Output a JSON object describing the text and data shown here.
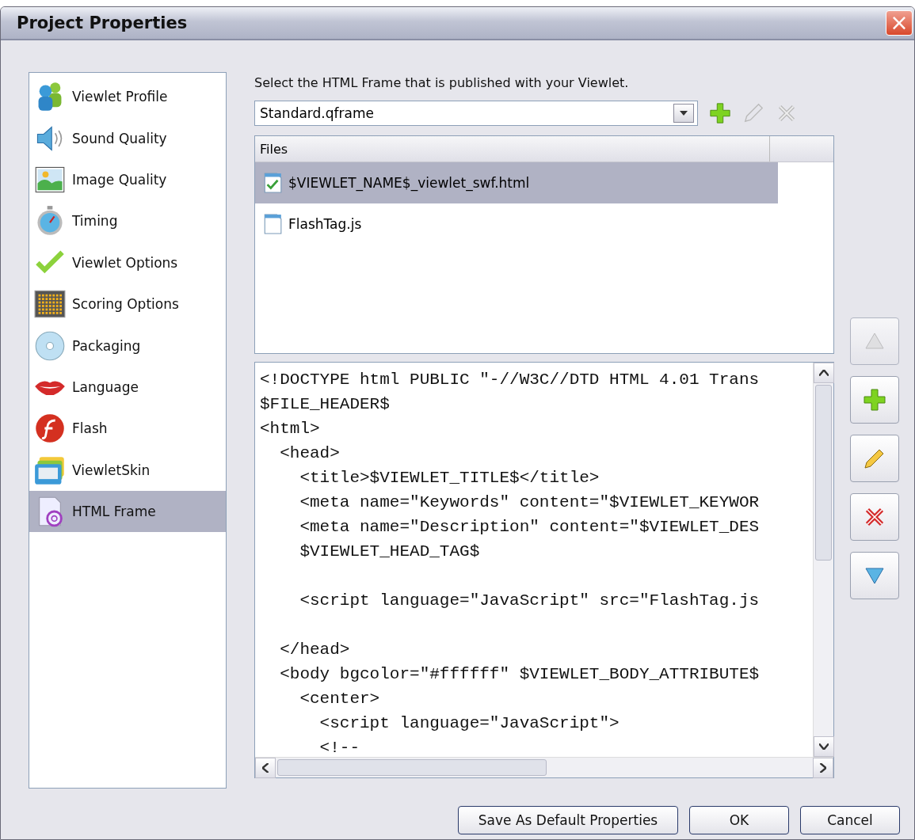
{
  "window": {
    "title": "Project Properties",
    "close": "×"
  },
  "sidebar": {
    "items": [
      {
        "label": "Viewlet Profile",
        "selected": false
      },
      {
        "label": "Sound Quality",
        "selected": false
      },
      {
        "label": "Image Quality",
        "selected": false
      },
      {
        "label": "Timing",
        "selected": false
      },
      {
        "label": "Viewlet Options",
        "selected": false
      },
      {
        "label": "Scoring Options",
        "selected": false
      },
      {
        "label": "Packaging",
        "selected": false
      },
      {
        "label": "Language",
        "selected": false
      },
      {
        "label": "Flash",
        "selected": false
      },
      {
        "label": "ViewletSkin",
        "selected": false
      },
      {
        "label": "HTML Frame",
        "selected": true
      }
    ]
  },
  "frame": {
    "prompt": "Select the HTML Frame that is published with your Viewlet.",
    "value": "Standard.qframe"
  },
  "files": {
    "columns": [
      "Files"
    ],
    "rows": [
      {
        "name": "$VIEWLET_NAME$_viewlet_swf.html",
        "selected": true
      },
      {
        "name": "FlashTag.js",
        "selected": false
      }
    ]
  },
  "code": {
    "blocks": [
      [
        "<!DOCTYPE html PUBLIC \"-//W3C//DTD HTML 4.01 Trans",
        "$FILE_HEADER$",
        "<html>",
        "  <head>",
        "    <title>$VIEWLET_TITLE$</title>",
        "    <meta name=\"Keywords\" content=\"$VIEWLET_KEYWOR",
        "    <meta name=\"Description\" content=\"$VIEWLET_DES",
        "    $VIEWLET_HEAD_TAG$"
      ],
      [
        "    <script language=\"JavaScript\" src=\"FlashTag.js"
      ],
      [
        "  </head>",
        "  <body bgcolor=\"#ffffff\" $VIEWLET_BODY_ATTRIBUTE$",
        "    <center>",
        "      <script language=\"JavaScript\">",
        "      <!--"
      ]
    ]
  },
  "side_buttons": [
    {
      "disabled": true
    },
    {
      "disabled": false
    },
    {
      "disabled": false
    },
    {
      "disabled": false
    },
    {
      "disabled": false
    }
  ],
  "buttons": [
    "Save As Default Properties",
    "OK",
    "Cancel"
  ]
}
